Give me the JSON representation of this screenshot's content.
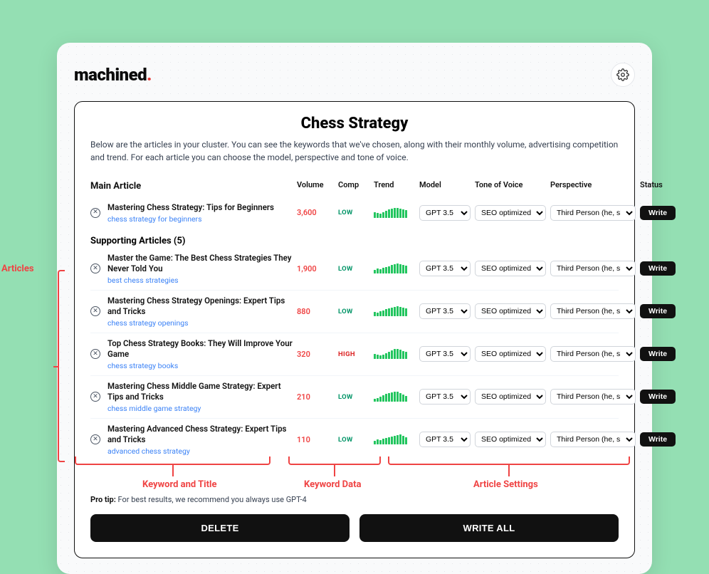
{
  "brand": {
    "name": "machined",
    "dot": "."
  },
  "settings_icon_name": "gear-icon",
  "cluster": {
    "title": "Chess Strategy",
    "description": "Below are the articles in your cluster. You can see the keywords that we've chosen, along with their monthly volume, advertising competition and trend. For each article you can choose the model, perspective and tone of voice."
  },
  "headers": {
    "main": "Main Article",
    "supporting": "Supporting Articles (5)",
    "volume": "Volume",
    "comp": "Comp",
    "trend": "Trend",
    "model": "Model",
    "tone": "Tone of Voice",
    "perspective": "Perspective",
    "status": "Status"
  },
  "options": {
    "model": "GPT 3.5",
    "tone": "SEO optimized (",
    "perspective": "Third Person (he, she, it, t",
    "write": "Write"
  },
  "main_article": {
    "title": "Mastering Chess Strategy: Tips for Beginners",
    "keyword": "chess strategy for beginners",
    "volume": "3,600",
    "comp": "LOW",
    "comp_class": "low",
    "trend": [
      6,
      5,
      4,
      6,
      8,
      10,
      11,
      12,
      12,
      11,
      10,
      9
    ]
  },
  "supporting": [
    {
      "title": "Master the Game: The Best Chess Strategies They Never Told You",
      "keyword": "best chess strategies",
      "volume": "1,900",
      "comp": "LOW",
      "comp_class": "low",
      "trend": [
        3,
        5,
        4,
        6,
        7,
        8,
        10,
        11,
        12,
        11,
        10,
        9
      ]
    },
    {
      "title": "Mastering Chess Strategy Openings: Expert Tips and Tricks",
      "keyword": "chess strategy openings",
      "volume": "880",
      "comp": "LOW",
      "comp_class": "low",
      "trend": [
        4,
        3,
        5,
        6,
        7,
        8,
        9,
        10,
        11,
        10,
        9,
        8
      ]
    },
    {
      "title": "Top Chess Strategy Books: They Will Improve Your Game",
      "keyword": "chess strategy books",
      "volume": "320",
      "comp": "HIGH",
      "comp_class": "high",
      "trend": [
        5,
        4,
        3,
        4,
        6,
        8,
        10,
        12,
        12,
        11,
        9,
        8
      ]
    },
    {
      "title": "Mastering Chess Middle Game Strategy: Expert Tips and Tricks",
      "keyword": "chess middle game strategy",
      "volume": "210",
      "comp": "LOW",
      "comp_class": "low",
      "trend": [
        2,
        3,
        5,
        7,
        9,
        10,
        11,
        12,
        12,
        10,
        8,
        6
      ]
    },
    {
      "title": "Mastering Advanced Chess Strategy: Expert Tips and Tricks",
      "keyword": "advanced chess strategy",
      "volume": "110",
      "comp": "LOW",
      "comp_class": "low",
      "trend": [
        3,
        5,
        4,
        6,
        7,
        8,
        9,
        10,
        11,
        12,
        10,
        8
      ]
    }
  ],
  "protip": {
    "label": "Pro tip:",
    "text": " For best results, we recommend you always use GPT-4"
  },
  "footer": {
    "delete": "DELETE",
    "write_all": "WRITE ALL"
  },
  "annotations": {
    "articles": "Articles",
    "kwtitle": "Keyword and Title",
    "kwdata": "Keyword Data",
    "settings": "Article Settings"
  }
}
